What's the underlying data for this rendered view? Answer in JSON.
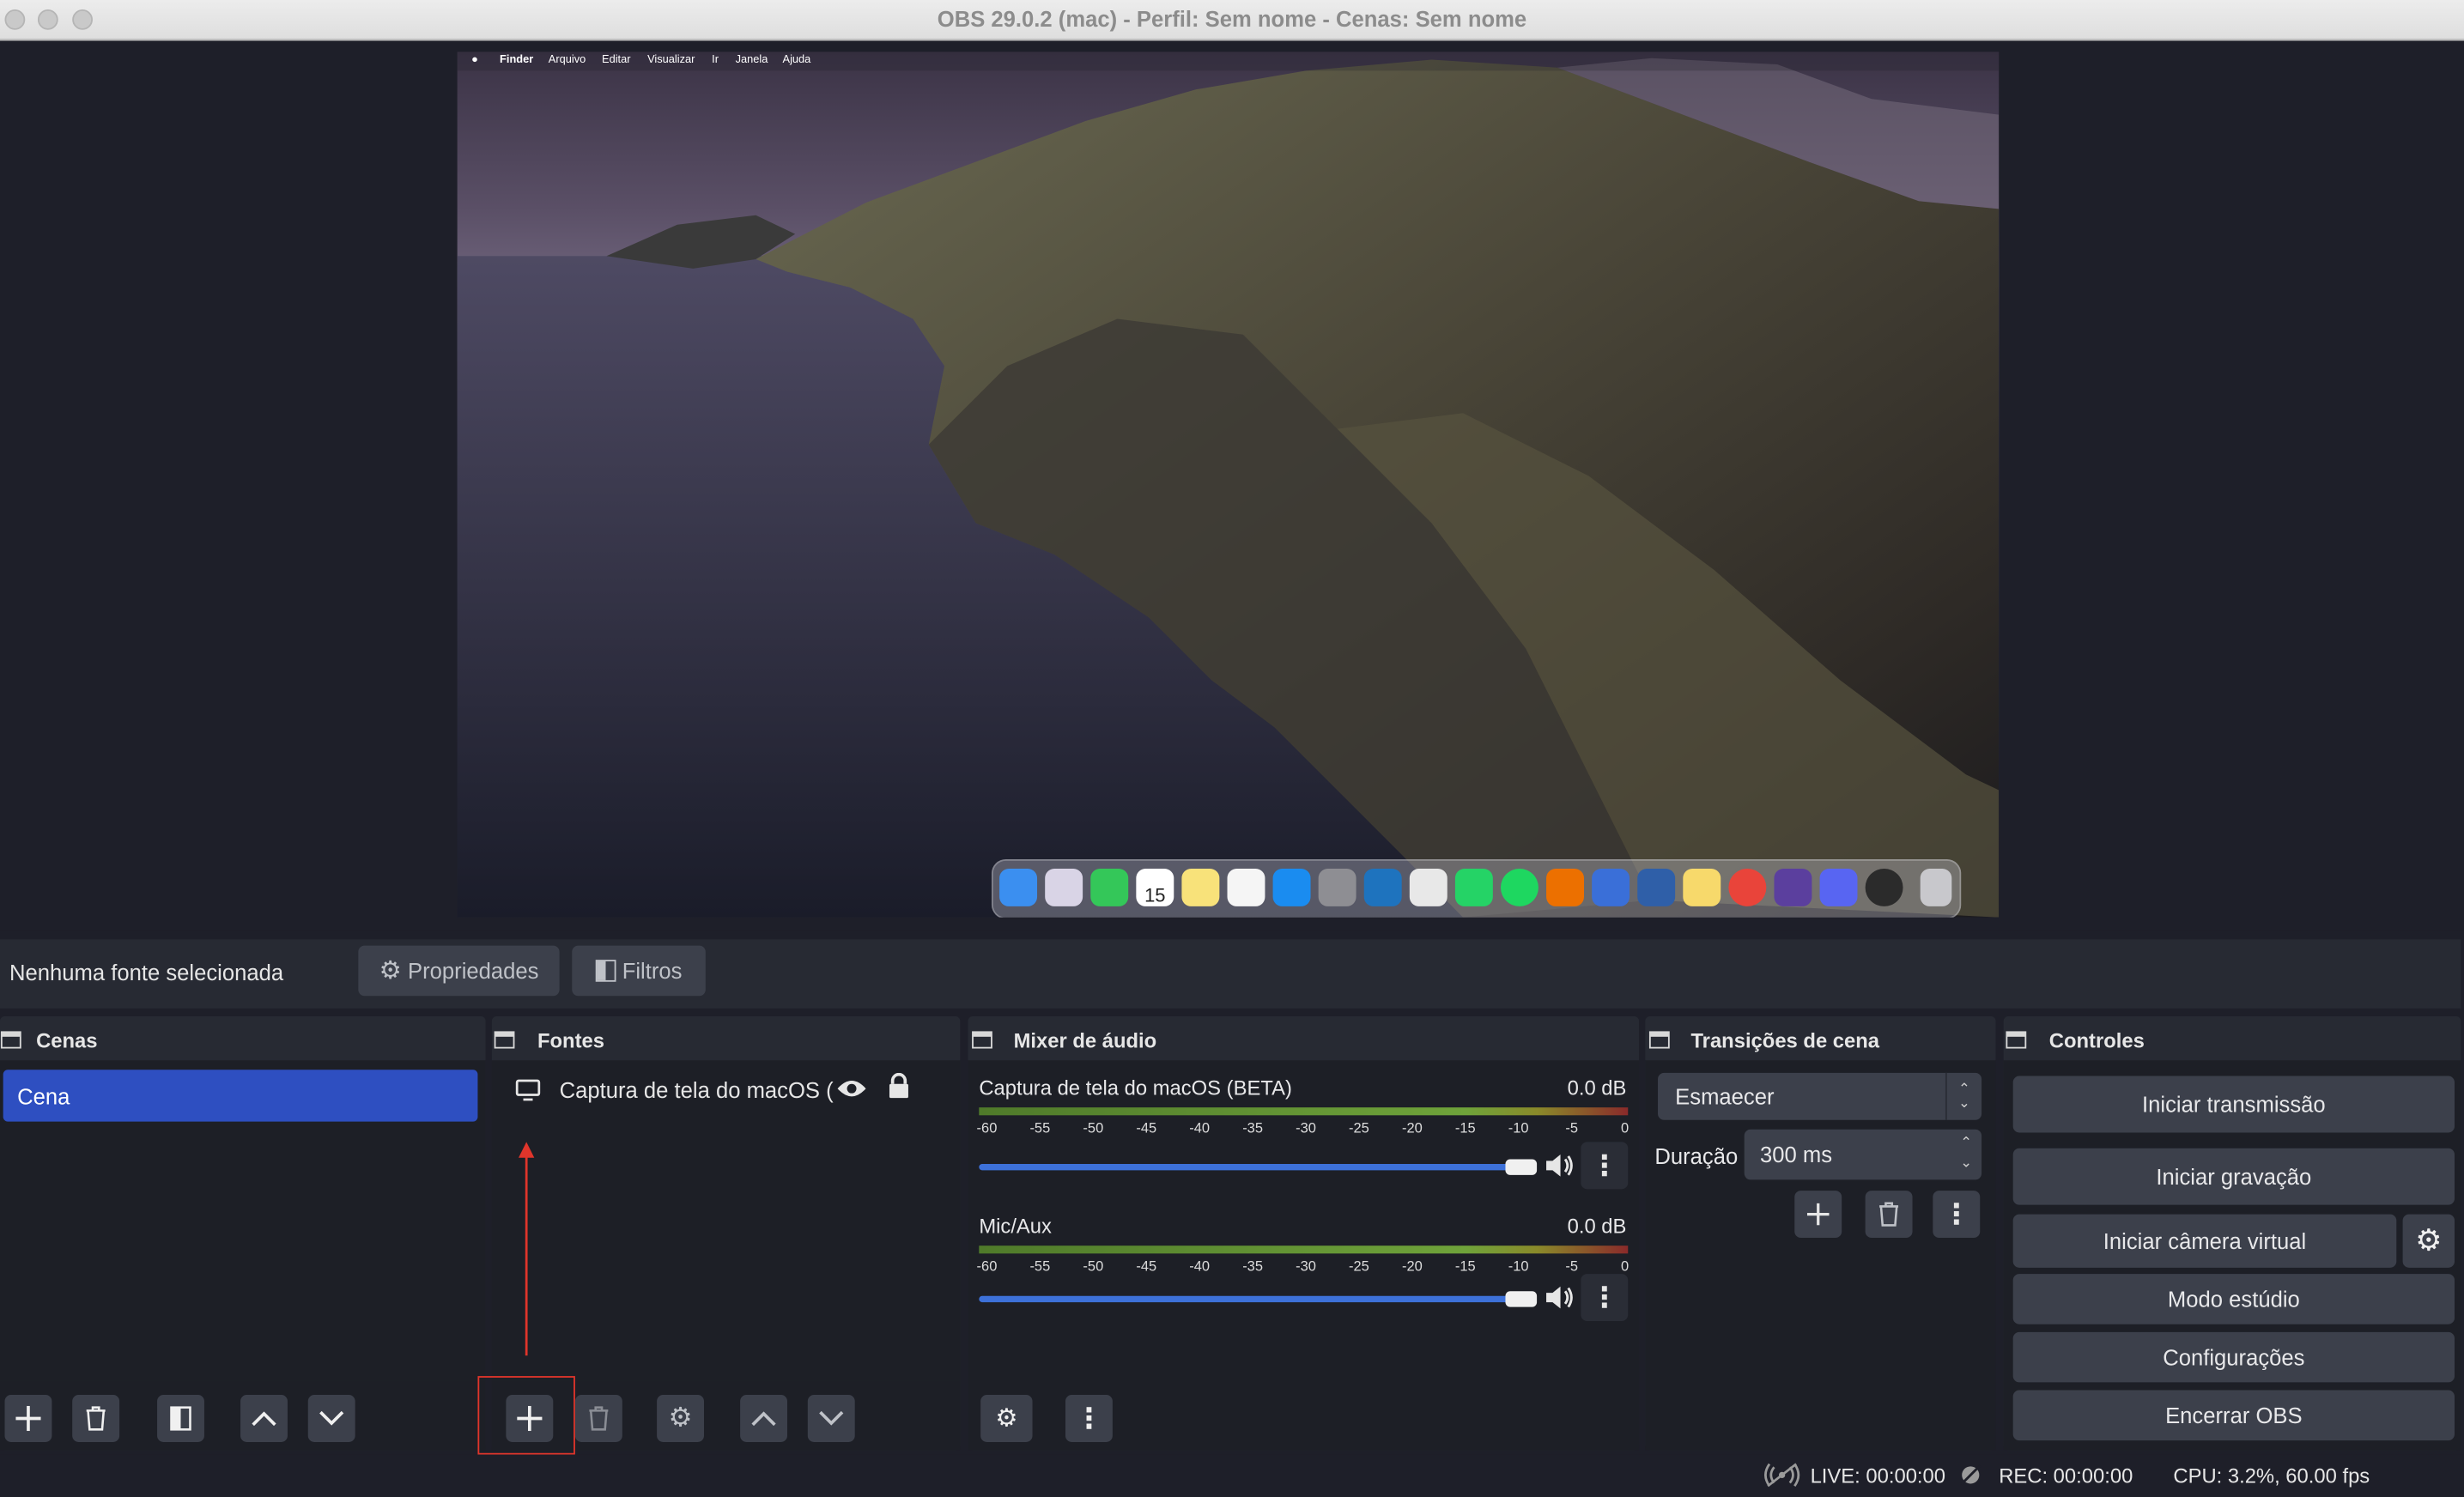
{
  "window": {
    "title": "OBS 29.0.2 (mac) - Perfil: Sem nome - Cenas: Sem nome"
  },
  "preview": {
    "mac_menubar": [
      "Finder",
      "Arquivo",
      "Editar",
      "Visualizar",
      "Ir",
      "Janela",
      "Ajuda"
    ],
    "dock_calendar_day": "15"
  },
  "source_toolbar": {
    "status": "Nenhuma fonte selecionada",
    "properties_label": "Propriedades",
    "filters_label": "Filtros"
  },
  "scenes": {
    "title": "Cenas",
    "items": [
      "Cena"
    ]
  },
  "sources": {
    "title": "Fontes",
    "items": [
      "Captura de tela do macOS ("
    ]
  },
  "mixer": {
    "title": "Mixer de áudio",
    "scale": [
      "-60",
      "-55",
      "-50",
      "-45",
      "-40",
      "-35",
      "-30",
      "-25",
      "-20",
      "-15",
      "-10",
      "-5",
      "0"
    ],
    "channels": [
      {
        "name": "Captura de tela do macOS (BETA)",
        "level": "0.0 dB",
        "volume": 1.0
      },
      {
        "name": "Mic/Aux",
        "level": "0.0 dB",
        "volume": 1.0
      }
    ]
  },
  "transitions": {
    "title": "Transições de cena",
    "selected": "Esmaecer",
    "duration_label": "Duração",
    "duration_value": "300 ms"
  },
  "controls": {
    "title": "Controles",
    "start_stream": "Iniciar transmissão",
    "start_recording": "Iniciar gravação",
    "start_virtual_cam": "Iniciar câmera virtual",
    "studio_mode": "Modo estúdio",
    "settings": "Configurações",
    "exit": "Encerrar OBS"
  },
  "status_bar": {
    "live": "LIVE: 00:00:00",
    "rec": "REC: 00:00:00",
    "cpu": "CPU: 3.2%, 60.00 fps"
  },
  "colors": {
    "accent_selection": "#2e4fc1",
    "highlight_annotation": "#e0352b",
    "panel_bg": "#272a33",
    "list_bg": "#1d1f26",
    "button_bg": "#3c404b",
    "slider": "#3d71d9"
  }
}
